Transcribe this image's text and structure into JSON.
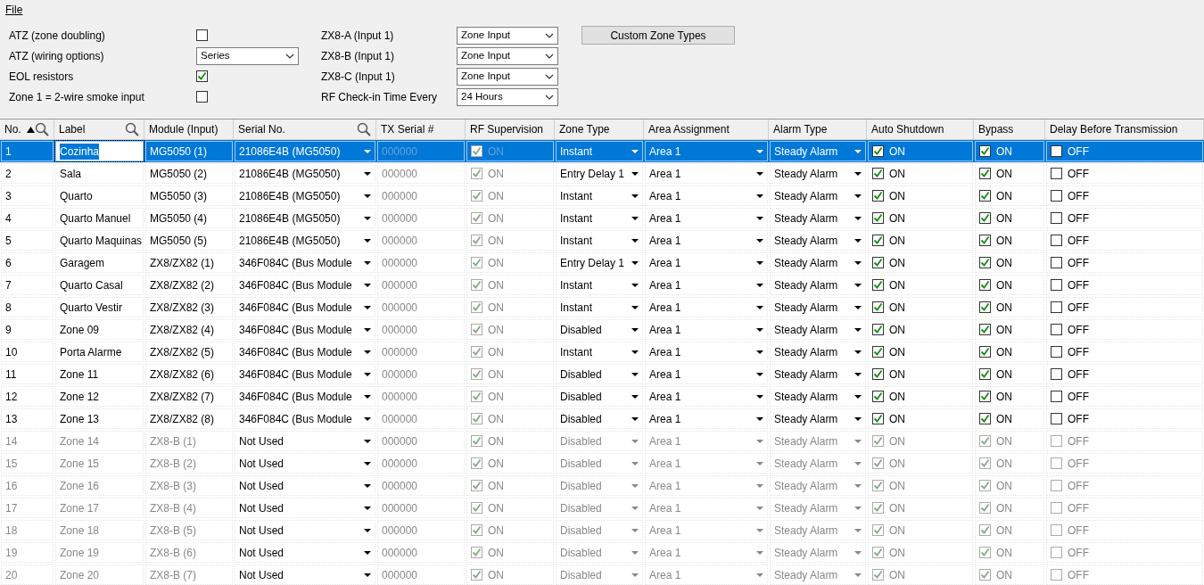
{
  "menu": [
    {
      "label": "File"
    }
  ],
  "settings_left": [
    {
      "kind": "checkbox",
      "label": "ATZ (zone doubling)",
      "checked": false
    },
    {
      "kind": "select",
      "label": "ATZ (wiring options)",
      "value": "Series"
    },
    {
      "kind": "checkbox",
      "label": "EOL resistors",
      "checked": true
    },
    {
      "kind": "checkbox",
      "label": "Zone 1 = 2-wire smoke input",
      "checked": false
    }
  ],
  "settings_right": [
    {
      "label": "ZX8-A (Input 1)",
      "value": "Zone Input"
    },
    {
      "label": "ZX8-B (Input 1)",
      "value": "Zone Input"
    },
    {
      "label": "ZX8-C (Input 1)",
      "value": "Zone Input"
    },
    {
      "label": "RF Check-in Time Every",
      "value": "24 Hours"
    }
  ],
  "custom_zone_types_button": "Custom Zone Types",
  "table": {
    "columns": [
      {
        "label": "No.",
        "sorted_ascending": true,
        "search": true
      },
      {
        "label": "Label",
        "search": true
      },
      {
        "label": "Module (Input)",
        "search": false
      },
      {
        "label": "Serial No.",
        "search": true
      },
      {
        "label": "TX Serial #",
        "search": false
      },
      {
        "label": "RF Supervision",
        "search": false
      },
      {
        "label": "Zone Type",
        "search": false
      },
      {
        "label": "Area Assignment",
        "search": false
      },
      {
        "label": "Alarm Type",
        "search": false
      },
      {
        "label": "Auto Shutdown",
        "search": false
      },
      {
        "label": "Bypass",
        "search": false
      },
      {
        "label": "Delay Before Transmission",
        "search": false
      }
    ],
    "rows": [
      {
        "no": "1",
        "label": "Cozinha",
        "module": "MG5050   (1)",
        "serial": "21086E4B (MG5050)",
        "tx_serial": "000000",
        "rf_supervision": {
          "checked": true,
          "text": "ON"
        },
        "zone_type": "Instant",
        "area": "Area 1",
        "alarm_type": "Steady Alarm",
        "auto_shutdown": {
          "checked": true,
          "text": "ON"
        },
        "bypass": {
          "checked": true,
          "text": "ON"
        },
        "delay": {
          "checked": false,
          "text": "OFF"
        },
        "selected": true,
        "disabled": false
      },
      {
        "no": "2",
        "label": "Sala",
        "module": "MG5050   (2)",
        "serial": "21086E4B (MG5050)",
        "tx_serial": "000000",
        "rf_supervision": {
          "checked": true,
          "text": "ON"
        },
        "zone_type": "Entry Delay 1",
        "area": "Area 1",
        "alarm_type": "Steady Alarm",
        "auto_shutdown": {
          "checked": true,
          "text": "ON"
        },
        "bypass": {
          "checked": true,
          "text": "ON"
        },
        "delay": {
          "checked": false,
          "text": "OFF"
        },
        "selected": false,
        "disabled": false
      },
      {
        "no": "3",
        "label": "Quarto",
        "module": "MG5050   (3)",
        "serial": "21086E4B (MG5050)",
        "tx_serial": "000000",
        "rf_supervision": {
          "checked": true,
          "text": "ON"
        },
        "zone_type": "Instant",
        "area": "Area 1",
        "alarm_type": "Steady Alarm",
        "auto_shutdown": {
          "checked": true,
          "text": "ON"
        },
        "bypass": {
          "checked": true,
          "text": "ON"
        },
        "delay": {
          "checked": false,
          "text": "OFF"
        },
        "selected": false,
        "disabled": false
      },
      {
        "no": "4",
        "label": "Quarto Manuel",
        "module": "MG5050   (4)",
        "serial": "21086E4B (MG5050)",
        "tx_serial": "000000",
        "rf_supervision": {
          "checked": true,
          "text": "ON"
        },
        "zone_type": "Instant",
        "area": "Area 1",
        "alarm_type": "Steady Alarm",
        "auto_shutdown": {
          "checked": true,
          "text": "ON"
        },
        "bypass": {
          "checked": true,
          "text": "ON"
        },
        "delay": {
          "checked": false,
          "text": "OFF"
        },
        "selected": false,
        "disabled": false
      },
      {
        "no": "5",
        "label": "Quarto Maquinas",
        "module": "MG5050   (5)",
        "serial": "21086E4B (MG5050)",
        "tx_serial": "000000",
        "rf_supervision": {
          "checked": true,
          "text": "ON"
        },
        "zone_type": "Instant",
        "area": "Area 1",
        "alarm_type": "Steady Alarm",
        "auto_shutdown": {
          "checked": true,
          "text": "ON"
        },
        "bypass": {
          "checked": true,
          "text": "ON"
        },
        "delay": {
          "checked": false,
          "text": "OFF"
        },
        "selected": false,
        "disabled": false
      },
      {
        "no": "6",
        "label": "Garagem",
        "module": "ZX8/ZX82 (1)",
        "serial": "346F084C (Bus Module",
        "tx_serial": "000000",
        "rf_supervision": {
          "checked": true,
          "text": "ON"
        },
        "zone_type": "Entry Delay 1",
        "area": "Area 1",
        "alarm_type": "Steady Alarm",
        "auto_shutdown": {
          "checked": true,
          "text": "ON"
        },
        "bypass": {
          "checked": true,
          "text": "ON"
        },
        "delay": {
          "checked": false,
          "text": "OFF"
        },
        "selected": false,
        "disabled": false
      },
      {
        "no": "7",
        "label": "Quarto Casal",
        "module": "ZX8/ZX82 (2)",
        "serial": "346F084C (Bus Module",
        "tx_serial": "000000",
        "rf_supervision": {
          "checked": true,
          "text": "ON"
        },
        "zone_type": "Instant",
        "area": "Area 1",
        "alarm_type": "Steady Alarm",
        "auto_shutdown": {
          "checked": true,
          "text": "ON"
        },
        "bypass": {
          "checked": true,
          "text": "ON"
        },
        "delay": {
          "checked": false,
          "text": "OFF"
        },
        "selected": false,
        "disabled": false
      },
      {
        "no": "8",
        "label": "Quarto Vestir",
        "module": "ZX8/ZX82 (3)",
        "serial": "346F084C (Bus Module",
        "tx_serial": "000000",
        "rf_supervision": {
          "checked": true,
          "text": "ON"
        },
        "zone_type": "Instant",
        "area": "Area 1",
        "alarm_type": "Steady Alarm",
        "auto_shutdown": {
          "checked": true,
          "text": "ON"
        },
        "bypass": {
          "checked": true,
          "text": "ON"
        },
        "delay": {
          "checked": false,
          "text": "OFF"
        },
        "selected": false,
        "disabled": false
      },
      {
        "no": "9",
        "label": "Zone 09",
        "module": "ZX8/ZX82 (4)",
        "serial": "346F084C (Bus Module",
        "tx_serial": "000000",
        "rf_supervision": {
          "checked": true,
          "text": "ON"
        },
        "zone_type": "Disabled",
        "area": "Area 1",
        "alarm_type": "Steady Alarm",
        "auto_shutdown": {
          "checked": true,
          "text": "ON"
        },
        "bypass": {
          "checked": true,
          "text": "ON"
        },
        "delay": {
          "checked": false,
          "text": "OFF"
        },
        "selected": false,
        "disabled": false
      },
      {
        "no": "10",
        "label": "Porta Alarme",
        "module": "ZX8/ZX82 (5)",
        "serial": "346F084C (Bus Module",
        "tx_serial": "000000",
        "rf_supervision": {
          "checked": true,
          "text": "ON"
        },
        "zone_type": "Instant",
        "area": "Area 1",
        "alarm_type": "Steady Alarm",
        "auto_shutdown": {
          "checked": true,
          "text": "ON"
        },
        "bypass": {
          "checked": true,
          "text": "ON"
        },
        "delay": {
          "checked": false,
          "text": "OFF"
        },
        "selected": false,
        "disabled": false
      },
      {
        "no": "11",
        "label": "Zone 11",
        "module": "ZX8/ZX82 (6)",
        "serial": "346F084C (Bus Module",
        "tx_serial": "000000",
        "rf_supervision": {
          "checked": true,
          "text": "ON"
        },
        "zone_type": "Disabled",
        "area": "Area 1",
        "alarm_type": "Steady Alarm",
        "auto_shutdown": {
          "checked": true,
          "text": "ON"
        },
        "bypass": {
          "checked": true,
          "text": "ON"
        },
        "delay": {
          "checked": false,
          "text": "OFF"
        },
        "selected": false,
        "disabled": false
      },
      {
        "no": "12",
        "label": "Zone 12",
        "module": "ZX8/ZX82 (7)",
        "serial": "346F084C (Bus Module",
        "tx_serial": "000000",
        "rf_supervision": {
          "checked": true,
          "text": "ON"
        },
        "zone_type": "Disabled",
        "area": "Area 1",
        "alarm_type": "Steady Alarm",
        "auto_shutdown": {
          "checked": true,
          "text": "ON"
        },
        "bypass": {
          "checked": true,
          "text": "ON"
        },
        "delay": {
          "checked": false,
          "text": "OFF"
        },
        "selected": false,
        "disabled": false
      },
      {
        "no": "13",
        "label": "Zone 13",
        "module": "ZX8/ZX82 (8)",
        "serial": "346F084C (Bus Module",
        "tx_serial": "000000",
        "rf_supervision": {
          "checked": true,
          "text": "ON"
        },
        "zone_type": "Disabled",
        "area": "Area 1",
        "alarm_type": "Steady Alarm",
        "auto_shutdown": {
          "checked": true,
          "text": "ON"
        },
        "bypass": {
          "checked": true,
          "text": "ON"
        },
        "delay": {
          "checked": false,
          "text": "OFF"
        },
        "selected": false,
        "disabled": false
      },
      {
        "no": "14",
        "label": "Zone 14",
        "module": "ZX8-B (1)",
        "serial": "Not Used",
        "tx_serial": "000000",
        "rf_supervision": {
          "checked": true,
          "text": "ON"
        },
        "zone_type": "Disabled",
        "area": "Area 1",
        "alarm_type": "Steady Alarm",
        "auto_shutdown": {
          "checked": true,
          "text": "ON"
        },
        "bypass": {
          "checked": true,
          "text": "ON"
        },
        "delay": {
          "checked": false,
          "text": "OFF"
        },
        "selected": false,
        "disabled": true
      },
      {
        "no": "15",
        "label": "Zone 15",
        "module": "ZX8-B (2)",
        "serial": "Not Used",
        "tx_serial": "000000",
        "rf_supervision": {
          "checked": true,
          "text": "ON"
        },
        "zone_type": "Disabled",
        "area": "Area 1",
        "alarm_type": "Steady Alarm",
        "auto_shutdown": {
          "checked": true,
          "text": "ON"
        },
        "bypass": {
          "checked": true,
          "text": "ON"
        },
        "delay": {
          "checked": false,
          "text": "OFF"
        },
        "selected": false,
        "disabled": true
      },
      {
        "no": "16",
        "label": "Zone 16",
        "module": "ZX8-B (3)",
        "serial": "Not Used",
        "tx_serial": "000000",
        "rf_supervision": {
          "checked": true,
          "text": "ON"
        },
        "zone_type": "Disabled",
        "area": "Area 1",
        "alarm_type": "Steady Alarm",
        "auto_shutdown": {
          "checked": true,
          "text": "ON"
        },
        "bypass": {
          "checked": true,
          "text": "ON"
        },
        "delay": {
          "checked": false,
          "text": "OFF"
        },
        "selected": false,
        "disabled": true
      },
      {
        "no": "17",
        "label": "Zone 17",
        "module": "ZX8-B (4)",
        "serial": "Not Used",
        "tx_serial": "000000",
        "rf_supervision": {
          "checked": true,
          "text": "ON"
        },
        "zone_type": "Disabled",
        "area": "Area 1",
        "alarm_type": "Steady Alarm",
        "auto_shutdown": {
          "checked": true,
          "text": "ON"
        },
        "bypass": {
          "checked": true,
          "text": "ON"
        },
        "delay": {
          "checked": false,
          "text": "OFF"
        },
        "selected": false,
        "disabled": true
      },
      {
        "no": "18",
        "label": "Zone 18",
        "module": "ZX8-B (5)",
        "serial": "Not Used",
        "tx_serial": "000000",
        "rf_supervision": {
          "checked": true,
          "text": "ON"
        },
        "zone_type": "Disabled",
        "area": "Area 1",
        "alarm_type": "Steady Alarm",
        "auto_shutdown": {
          "checked": true,
          "text": "ON"
        },
        "bypass": {
          "checked": true,
          "text": "ON"
        },
        "delay": {
          "checked": false,
          "text": "OFF"
        },
        "selected": false,
        "disabled": true
      },
      {
        "no": "19",
        "label": "Zone 19",
        "module": "ZX8-B (6)",
        "serial": "Not Used",
        "tx_serial": "000000",
        "rf_supervision": {
          "checked": true,
          "text": "ON"
        },
        "zone_type": "Disabled",
        "area": "Area 1",
        "alarm_type": "Steady Alarm",
        "auto_shutdown": {
          "checked": true,
          "text": "ON"
        },
        "bypass": {
          "checked": true,
          "text": "ON"
        },
        "delay": {
          "checked": false,
          "text": "OFF"
        },
        "selected": false,
        "disabled": true
      },
      {
        "no": "20",
        "label": "Zone 20",
        "module": "ZX8-B (7)",
        "serial": "Not Used",
        "tx_serial": "000000",
        "rf_supervision": {
          "checked": true,
          "text": "ON"
        },
        "zone_type": "Disabled",
        "area": "Area 1",
        "alarm_type": "Steady Alarm",
        "auto_shutdown": {
          "checked": true,
          "text": "ON"
        },
        "bypass": {
          "checked": true,
          "text": "ON"
        },
        "delay": {
          "checked": false,
          "text": "OFF"
        },
        "selected": false,
        "disabled": true
      }
    ]
  }
}
